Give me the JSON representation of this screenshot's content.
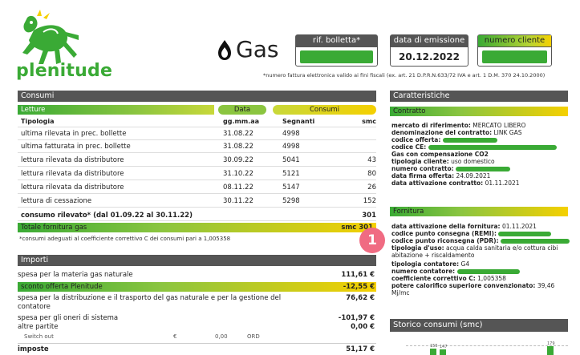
{
  "brand": {
    "name": "plenitude"
  },
  "header": {
    "product": "Gas",
    "rif_bolletta_label": "rif. bolletta*",
    "data_emissione_label": "data di emissione",
    "data_emissione_value": "20.12.2022",
    "numero_cliente_label": "numero cliente",
    "note": "*numero fattura elettronica valido ai fini fiscali (ex. art. 21 D.P.R.N.633/72 IVA e art. 1 D.M. 370 24.10.2000)"
  },
  "consumi": {
    "title": "Consumi",
    "col_letture": "Letture",
    "col_data": "Data",
    "col_consumi": "Consumi",
    "sub_tipologia": "Tipologia",
    "sub_data": "gg.mm.aa",
    "sub_segnanti": "Segnanti",
    "sub_smc": "smc",
    "rows": [
      {
        "tipo": "ultima rilevata in prec. bollette",
        "data": "31.08.22",
        "segnanti": "4998",
        "smc": ""
      },
      {
        "tipo": "ultima fatturata in prec. bollette",
        "data": "31.08.22",
        "segnanti": "4998",
        "smc": ""
      },
      {
        "tipo": "lettura rilevata da distributore",
        "data": "30.09.22",
        "segnanti": "5041",
        "smc": "43"
      },
      {
        "tipo": "lettura rilevata da distributore",
        "data": "31.10.22",
        "segnanti": "5121",
        "smc": "80"
      },
      {
        "tipo": "lettura rilevata da distributore",
        "data": "08.11.22",
        "segnanti": "5147",
        "smc": "26"
      },
      {
        "tipo": "lettura di cessazione",
        "data": "30.11.22",
        "segnanti": "5298",
        "smc": "152"
      }
    ],
    "consumo_rilevato_label": "consumo rilevato* (dal 01.09.22 al 30.11.22)",
    "consumo_rilevato_value": "301",
    "totale_label": "Totale fornitura gas",
    "totale_value": "smc 301",
    "footnote": "*consumi adeguati al coefficiente correttivo C dei consumi pari a 1,005358"
  },
  "importi": {
    "title": "Importi",
    "rows": [
      {
        "label": "spesa per la materia gas naturale",
        "amount": "111,61 €",
        "style": "plain"
      },
      {
        "label": "sconto offerta Plenitude",
        "amount": "-12,55 €",
        "style": "green"
      },
      {
        "label": "spesa per la distribuzione e il trasporto del gas naturale e per la gestione del contatore",
        "amount": "76,62 €",
        "style": "plain"
      },
      {
        "label": "spesa per gli oneri di sistema",
        "amount": "-101,97 €",
        "style": "plain"
      },
      {
        "label": "altre partite",
        "amount": "0,00 €",
        "style": "plain"
      }
    ],
    "switch_out": {
      "label": "Switch out",
      "currency": "€",
      "value": "0,00",
      "code": "ORD"
    },
    "imposte_label": "imposte",
    "imposte_value": "51,17 €"
  },
  "caratteristiche": {
    "title": "Caratteristiche",
    "contratto_title": "Contratto",
    "mercato_label": "mercato di riferimento:",
    "mercato_value": "MERCATO LIBERO",
    "denominazione_label": "denominazione del contratto:",
    "denominazione_value": "LINK GAS",
    "codice_offerta_label": "codice offerta:",
    "codice_ce_label": "codice CE:",
    "gas_comp": "Gas con compensazione CO2",
    "tipologia_cliente_label": "tipologia cliente:",
    "tipologia_cliente_value": "uso domestico",
    "numero_contratto_label": "numero contratto:",
    "data_firma_label": "data firma offerta:",
    "data_firma_value": "24.09.2021",
    "data_attivazione_label": "data attivazione contratto:",
    "data_attivazione_value": "01.11.2021",
    "fornitura_title": "Fornitura",
    "data_att_forn_label": "data attivazione della fornitura:",
    "data_att_forn_value": "01.11.2021",
    "remi_label": "codice punto consegna (REMI):",
    "pdr_label": "codice punto riconsegna (PDR):",
    "tipologia_uso_label": "tipologia d'uso:",
    "tipologia_uso_value": "acqua calda sanitaria e/o cottura cibi abitazione + riscaldamento",
    "tipologia_contatore_label": "tipologia contatore:",
    "tipologia_contatore_value": "G4",
    "numero_contatore_label": "numero contatore:",
    "coeff_label": "coefficiente correttivo C:",
    "coeff_value": "1,005358",
    "potere_label": "potere calorifico superiore convenzionato:",
    "potere_value": "39,46 Mj/mc"
  },
  "storico": {
    "title": "Storico consumi (smc)",
    "label1": "155",
    "label2": "147",
    "label3": "179"
  },
  "annotation": {
    "badge": "1"
  },
  "colors": {
    "green": "#3aaa35",
    "yellow": "#f5d000",
    "dark": "#555555",
    "badge": "#f06b82"
  }
}
